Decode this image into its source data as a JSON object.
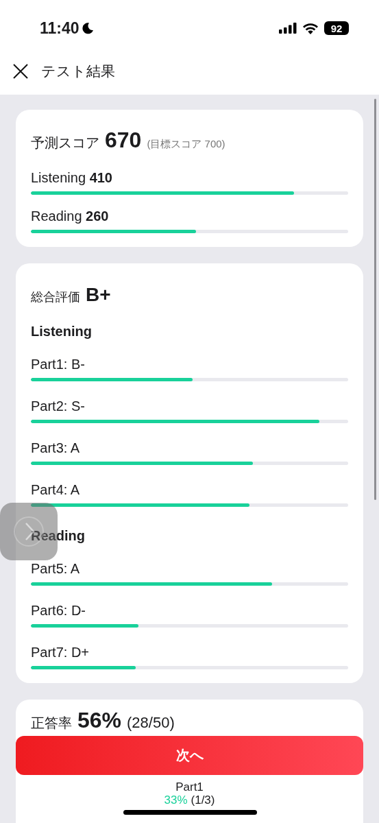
{
  "status_bar": {
    "time": "11:40",
    "battery": "92"
  },
  "header": {
    "title": "テスト結果"
  },
  "score_card": {
    "label": "予測スコア",
    "score": "670",
    "target": "(目標スコア 700)",
    "sections": [
      {
        "name": "Listening",
        "score": "410",
        "level": 0.83
      },
      {
        "name": "Reading",
        "score": "260",
        "level": 0.52
      }
    ]
  },
  "evaluation_card": {
    "label": "総合評価",
    "grade": "B+",
    "groups": [
      {
        "title": "Listening",
        "parts": [
          {
            "label": "Part1: B-",
            "level": 0.51
          },
          {
            "label": "Part2: S-",
            "level": 0.91
          },
          {
            "label": "Part3: A",
            "level": 0.7
          },
          {
            "label": "Part4: A",
            "level": 0.69
          }
        ]
      },
      {
        "title": "Reading",
        "parts": [
          {
            "label": "Part5: A",
            "level": 0.76
          },
          {
            "label": "Part6: D-",
            "level": 0.34
          },
          {
            "label": "Part7: D+",
            "level": 0.33
          }
        ]
      }
    ]
  },
  "accuracy_card": {
    "label": "正答率",
    "percent": "56%",
    "count": "(28/50)",
    "parts": [
      {
        "name": "Part1",
        "percent": "33%",
        "count": "(1/3)"
      }
    ]
  },
  "next_button": {
    "label": "次へ"
  }
}
